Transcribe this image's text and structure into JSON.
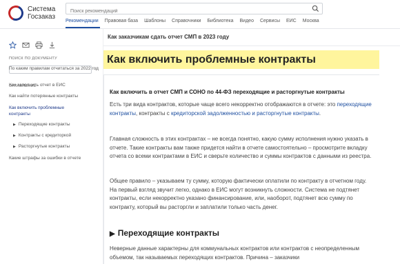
{
  "header": {
    "logo_line1": "Система",
    "logo_line2": "Госзаказ",
    "search_placeholder": "Поиск рекомендаций",
    "nav": [
      "Рекомендации",
      "Правовая база",
      "Шаблоны",
      "Справочники",
      "Библиотека",
      "Видео",
      "Сервисы",
      "ЕИС",
      "Москва"
    ],
    "active_nav": "Рекомендации"
  },
  "sidebar": {
    "tools": [
      "star-icon",
      "mail-icon",
      "print-icon",
      "download-icon"
    ],
    "search_label": "ПОИСК ПО ДОКУМЕНТУ",
    "toc_label": "ОГЛАВЛЕНИЕ",
    "toc": [
      {
        "label": "По каким правилам отчитаться за 2022 год"
      },
      {
        "label": "Как заполнить отчет в ЕИС"
      },
      {
        "label": "Как найти потерянные контракты"
      },
      {
        "label": "Как включить проблемные контракты"
      },
      {
        "label": "Переходящие контракты"
      },
      {
        "label": "Контракты с кредиторкой"
      },
      {
        "label": "Расторгнутые контракты"
      },
      {
        "label": "Какие штрафы за ошибки в отчете"
      }
    ]
  },
  "main": {
    "breadcrumb": "Как заказчикам сдать отчет СМП в 2023 году",
    "title": "Как включить проблемные контракты",
    "subtitle": "Как включить в отчет СМП и СОНО по 44-ФЗ переходящие и расторгнутые контракты",
    "p1_before": "Есть три вида контрактов, которые чаще всего некорректно отображаются в отчете: это ",
    "p1_link1": "переходящие контракты",
    "p1_mid": ", контракты с ",
    "p1_link2": "кредиторской задолженностью и расторгнутые контракты",
    "p1_end": ".",
    "p2": "Главная сложность в этих контрактах – не всегда понятно, какую сумму исполнения нужно указать в отчете. Такие контракты вам также придется найти в отчете самостоятельно – просмотрите вкладку отчета со всеми контрактами в ЕИС и сверьте количество и суммы контрактов с данными из реестра.",
    "p3": "Общее правило – указываем ту сумму, которую фактически оплатили по контракту в отчетном году. На первый взгляд звучит легко, однако в ЕИС могут возникнуть сложности. Система не подтянет контракты, если некорректно указано финансирование, или, наоборот, подтянет всю сумму по контракту, который вы расторгли и заплатили только часть денег.",
    "section": "Переходящие контракты",
    "p4": "Неверные данные характерны для коммунальных контрактов или контрактов с неопределенным объемом, так называемых переходящих контрактов. Причина – заказчики"
  }
}
